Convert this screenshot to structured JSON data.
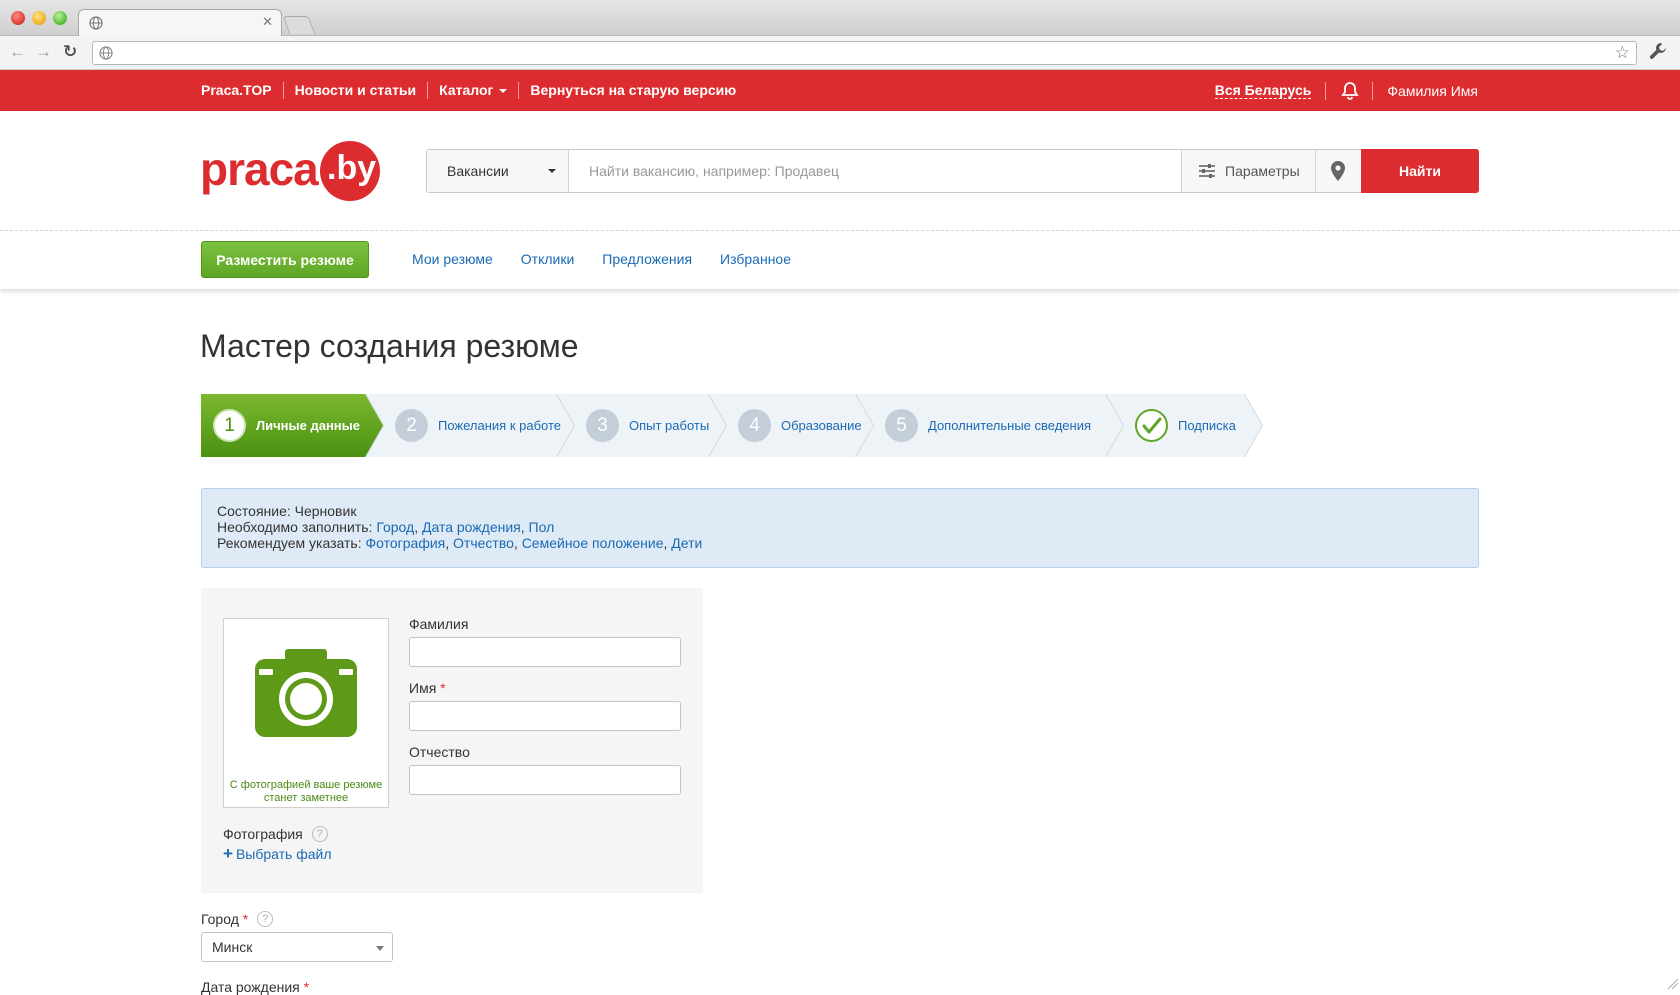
{
  "topnav": {
    "links": [
      "Praca.TOP",
      "Новости и статьи",
      "Каталог",
      "Вернуться на старую версию"
    ],
    "region": "Вся Беларусь",
    "username": "Фамилия Имя"
  },
  "logo": {
    "text": "praca",
    "suffix": ".by"
  },
  "search": {
    "category": "Вакансии",
    "placeholder": "Найти вакансию, например: Продавец",
    "params_label": "Параметры",
    "button_label": "Найти"
  },
  "subnav": {
    "post_button": "Разместить резюме",
    "links": [
      "Мои резюме",
      "Отклики",
      "Предложения",
      "Избранное"
    ]
  },
  "page_title": "Мастер создания резюме",
  "steps": [
    {
      "num": "1",
      "label": "Личные данные",
      "active": true
    },
    {
      "num": "2",
      "label": "Пожелания к работе"
    },
    {
      "num": "3",
      "label": "Опыт работы"
    },
    {
      "num": "4",
      "label": "Образование"
    },
    {
      "num": "5",
      "label": "Дополнительные сведения"
    },
    {
      "num": "",
      "label": "Подписка"
    }
  ],
  "info": {
    "status_prefix": "Состояние: ",
    "status": "Черновик",
    "required_prefix": "Необходимо заполнить: ",
    "required": [
      "Город",
      "Дата рождения",
      "Пол"
    ],
    "recommended_prefix": "Рекомендуем указать: ",
    "recommended": [
      "Фотография",
      "Отчество",
      "Семейное положение",
      "Дети"
    ]
  },
  "form": {
    "photo_hint": "С фотографией ваше резюме станет заметнее",
    "last_name_label": "Фамилия",
    "first_name_label": "Имя",
    "middle_name_label": "Отчество",
    "photo_label": "Фотография",
    "choose_file": "Выбрать файл",
    "city_label": "Город",
    "city_value": "Минск",
    "birthdate_label": "Дата рождения",
    "required_mark": "*",
    "help_mark": "?"
  },
  "colors": {
    "brand_red": "#dd2c2f",
    "green": "#5fa626",
    "link": "#1b6ab3",
    "info_bg": "#deebf6"
  }
}
